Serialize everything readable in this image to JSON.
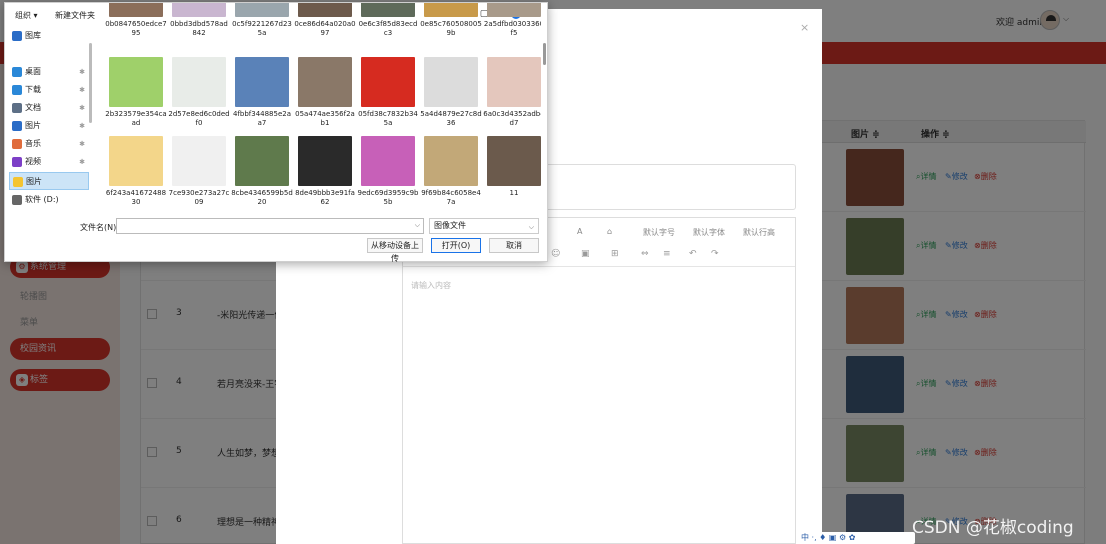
{
  "header": {
    "greeting": "欢迎 admin",
    "caret": "⌵"
  },
  "sidebar": {
    "items": [
      {
        "label": "系统管理",
        "style": "red",
        "icon": "gear-icon"
      },
      {
        "label": "轮播图",
        "style": "ghost"
      },
      {
        "label": "菜单",
        "style": "ghost"
      },
      {
        "label": "校园资讯",
        "style": "red"
      },
      {
        "label": "标签",
        "style": "red",
        "icon": "tag-icon"
      }
    ]
  },
  "table": {
    "columns": {
      "image": "图片 ≑",
      "action": "操作 ≑"
    },
    "actions": {
      "detail": "详情",
      "edit": "修改",
      "delete": "删除"
    },
    "rows": [
      {
        "num": "",
        "title": "",
        "thumb_color": "#8a4f3b"
      },
      {
        "num": "",
        "title": "",
        "thumb_color": "#6c7d52"
      },
      {
        "num": "3",
        "title": "-米阳光传递一份",
        "thumb_color": "#b5795a"
      },
      {
        "num": "4",
        "title": "若月亮没来-王宇",
        "thumb_color": "#3f5a7a"
      },
      {
        "num": "5",
        "title": "人生如梦，梦想",
        "thumb_color": "#7a8a64"
      },
      {
        "num": "6",
        "title": "理想是一种精神",
        "thumb_color": "#5a6c88"
      }
    ]
  },
  "modal": {
    "close": "×",
    "toolbar": [
      "A",
      "⌂",
      "默认字号",
      "默认字体",
      "默认行高"
    ],
    "toolbar2": [
      "☺",
      "▣",
      "⊞",
      "⇔",
      "≡",
      "↶",
      "↷"
    ],
    "editor_placeholder": "请输入内容"
  },
  "dialog": {
    "organize": "组织 ▾",
    "new_folder": "新建文件夹",
    "nav": [
      {
        "label": "图库",
        "color": "#2a6cc7",
        "pinned": false,
        "selected": false
      },
      {
        "label": "桌面",
        "color": "#2a88d8",
        "pinned": true,
        "selected": false
      },
      {
        "label": "下载",
        "color": "#2a88d8",
        "pinned": true,
        "selected": false
      },
      {
        "label": "文档",
        "color": "#5d6f86",
        "pinned": true,
        "selected": false
      },
      {
        "label": "图片",
        "color": "#2a6cc7",
        "pinned": true,
        "selected": false
      },
      {
        "label": "音乐",
        "color": "#e06c3c",
        "pinned": true,
        "selected": false
      },
      {
        "label": "视频",
        "color": "#7d3fc7",
        "pinned": true,
        "selected": false
      },
      {
        "label": "图片",
        "color": "#f4c430",
        "pinned": false,
        "selected": true
      },
      {
        "label": "软件 (D:)",
        "color": "#666666",
        "pinned": false,
        "selected": false
      }
    ],
    "files": [
      {
        "name": "0b0847650edce795",
        "color": "#8b6e5a"
      },
      {
        "name": "0bbd3dbd578ad842",
        "color": "#c9b6d0"
      },
      {
        "name": "0c5f9221267d235a",
        "color": "#9aa6ad"
      },
      {
        "name": "0ce86d64a020a097",
        "color": "#6d5a4c"
      },
      {
        "name": "0e6c3f85d83ecdc3",
        "color": "#5e6a5a"
      },
      {
        "name": "0e85c7605080059b",
        "color": "#c89a4a"
      },
      {
        "name": "2a5dfbd0303360f5",
        "color": "#a89a8a"
      },
      {
        "name": "2b323579e354caad",
        "color": "#9fd06a"
      },
      {
        "name": "2d57e8ed6c0dedf0",
        "color": "#e8ece8"
      },
      {
        "name": "4fbbf344885e2aa7",
        "color": "#5a82b8"
      },
      {
        "name": "05a474ae356f2ab1",
        "color": "#8a7868"
      },
      {
        "name": "05fd38c7832b345a",
        "color": "#d62b20"
      },
      {
        "name": "5a4d4879e27c8d36",
        "color": "#dcdcdc"
      },
      {
        "name": "6a0c3d4352adb4d7",
        "color": "#e4c7bd"
      },
      {
        "name": "6f243a4167248830",
        "color": "#f3d68a"
      },
      {
        "name": "7ce930e273a27c09",
        "color": "#f0f0f0"
      },
      {
        "name": "8cbe4346599b5d20",
        "color": "#5f7a4c"
      },
      {
        "name": "8de49bbb3e91fa62",
        "color": "#2a2a2a"
      },
      {
        "name": "9edc69d3959c9b5b",
        "color": "#c760b8"
      },
      {
        "name": "9f69b84c6058e47a",
        "color": "#c2a878"
      },
      {
        "name": "11",
        "color": "#6b5a4c"
      }
    ],
    "filename_label": "文件名(N):",
    "filename_value": "",
    "filetype": "图像文件",
    "buttons": {
      "mobile": "从移动设备上传",
      "open": "打开(O)",
      "cancel": "取消"
    }
  },
  "watermark": "CSDN @花椒coding",
  "ime": "中 ·, ♦ ▣ ⚙ ✿"
}
